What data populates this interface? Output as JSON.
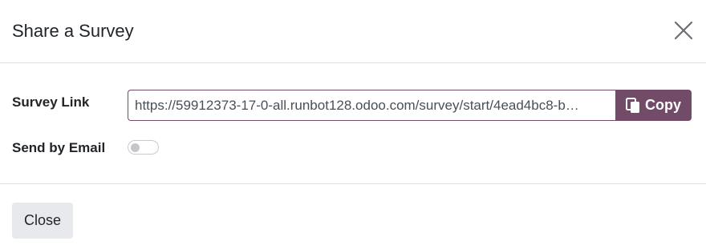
{
  "dialog": {
    "title": "Share a Survey",
    "close_icon": "close-icon"
  },
  "form": {
    "survey_link_label": "Survey Link",
    "survey_link_value": "https://59912373-17-0-all.runbot128.odoo.com/survey/start/4ead4bc8-b…",
    "copy_label": "Copy",
    "copy_icon": "clipboard-icon",
    "send_by_email_label": "Send by Email",
    "send_by_email_enabled": false
  },
  "footer": {
    "close_label": "Close"
  },
  "colors": {
    "brand": "#714b67",
    "close_button_bg": "#e7e9ed"
  }
}
